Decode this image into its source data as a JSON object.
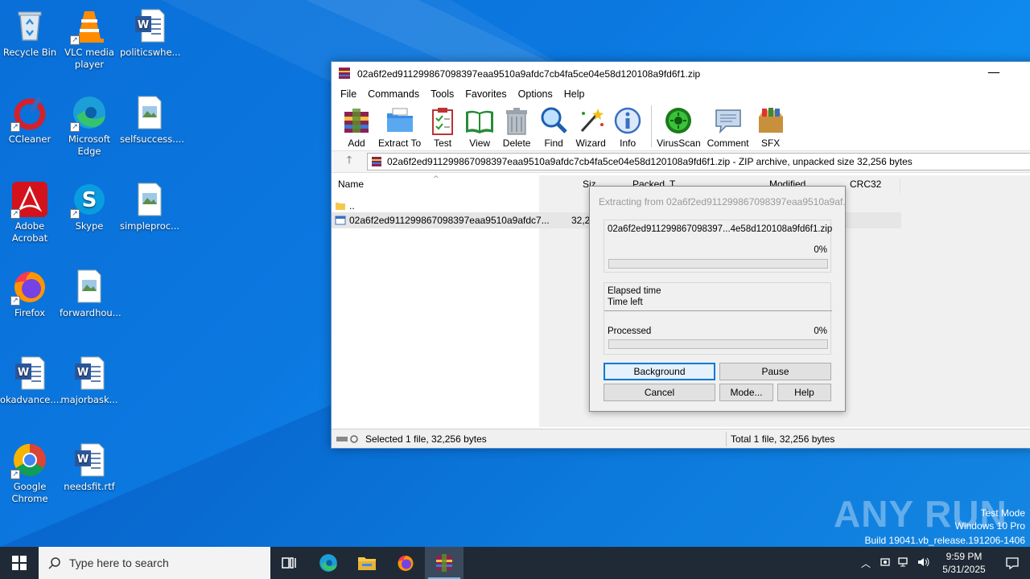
{
  "desktop": {
    "icons": [
      {
        "label": "Recycle Bin",
        "icon": "recycle-bin-icon"
      },
      {
        "label": "VLC media player",
        "icon": "vlc-icon"
      },
      {
        "label": "politicswhe...",
        "icon": "word-document-icon"
      },
      {
        "label": "CCleaner",
        "icon": "ccleaner-icon"
      },
      {
        "label": "Microsoft Edge",
        "icon": "edge-icon"
      },
      {
        "label": "selfsuccess....",
        "icon": "image-file-icon"
      },
      {
        "label": "Adobe Acrobat",
        "icon": "acrobat-icon"
      },
      {
        "label": "Skype",
        "icon": "skype-icon"
      },
      {
        "label": "simpleproc...",
        "icon": "image-file-icon"
      },
      {
        "label": "Firefox",
        "icon": "firefox-icon"
      },
      {
        "label": "forwardhou...",
        "icon": "image-file-icon"
      },
      {
        "label": "okadvance....",
        "icon": "word-document-icon"
      },
      {
        "label": "majorbask...",
        "icon": "word-document-icon"
      },
      {
        "label": "Google Chrome",
        "icon": "chrome-icon"
      },
      {
        "label": "needsfit.rtf",
        "icon": "word-document-icon"
      }
    ]
  },
  "winrar": {
    "title": "02a6f2ed911299867098397eaa9510a9afdc7cb4fa5ce04e58d120108a9fd6f1.zip",
    "minimize": "—",
    "menu": [
      "File",
      "Commands",
      "Tools",
      "Favorites",
      "Options",
      "Help"
    ],
    "toolbar": [
      "Add",
      "Extract To",
      "Test",
      "View",
      "Delete",
      "Find",
      "Wizard",
      "Info",
      "VirusScan",
      "Comment",
      "SFX"
    ],
    "path": "02a6f2ed911299867098397eaa9510a9afdc7cb4fa5ce04e58d120108a9fd6f1.zip - ZIP archive, unpacked size 32,256 bytes",
    "columns": {
      "name": "Name",
      "size": "Siz",
      "packed": "Packed",
      "type": "T",
      "modified": "Modified",
      "crc": "CRC32"
    },
    "rows": [
      {
        "name": "..",
        "size": ""
      },
      {
        "name": "02a6f2ed911299867098397eaa9510a9afdc7...",
        "size": "32,2"
      }
    ],
    "status_left": "Selected 1 file, 32,256 bytes",
    "status_right": "Total 1 file, 32,256 bytes"
  },
  "extract_dialog": {
    "title": "Extracting from 02a6f2ed911299867098397eaa9510a9af...",
    "filename": "02a6f2ed911299867098397...4e58d120108a9fd6f1.zip",
    "file_percent": "0%",
    "file_progress": 0,
    "elapsed_label": "Elapsed time",
    "time_left_label": "Time left",
    "processed_label": "Processed",
    "processed_percent": "0%",
    "processed_progress": 0,
    "buttons": {
      "background": "Background",
      "pause": "Pause",
      "cancel": "Cancel",
      "mode": "Mode...",
      "help": "Help"
    }
  },
  "taskbar": {
    "search_placeholder": "Type here to search",
    "time": "9:59 PM",
    "date": "5/31/2025"
  },
  "watermark": {
    "brand": "ANY RUN",
    "mode": "Test Mode",
    "os": "Windows 10 Pro",
    "build": "Build 19041.vb_release.191206-1406"
  }
}
